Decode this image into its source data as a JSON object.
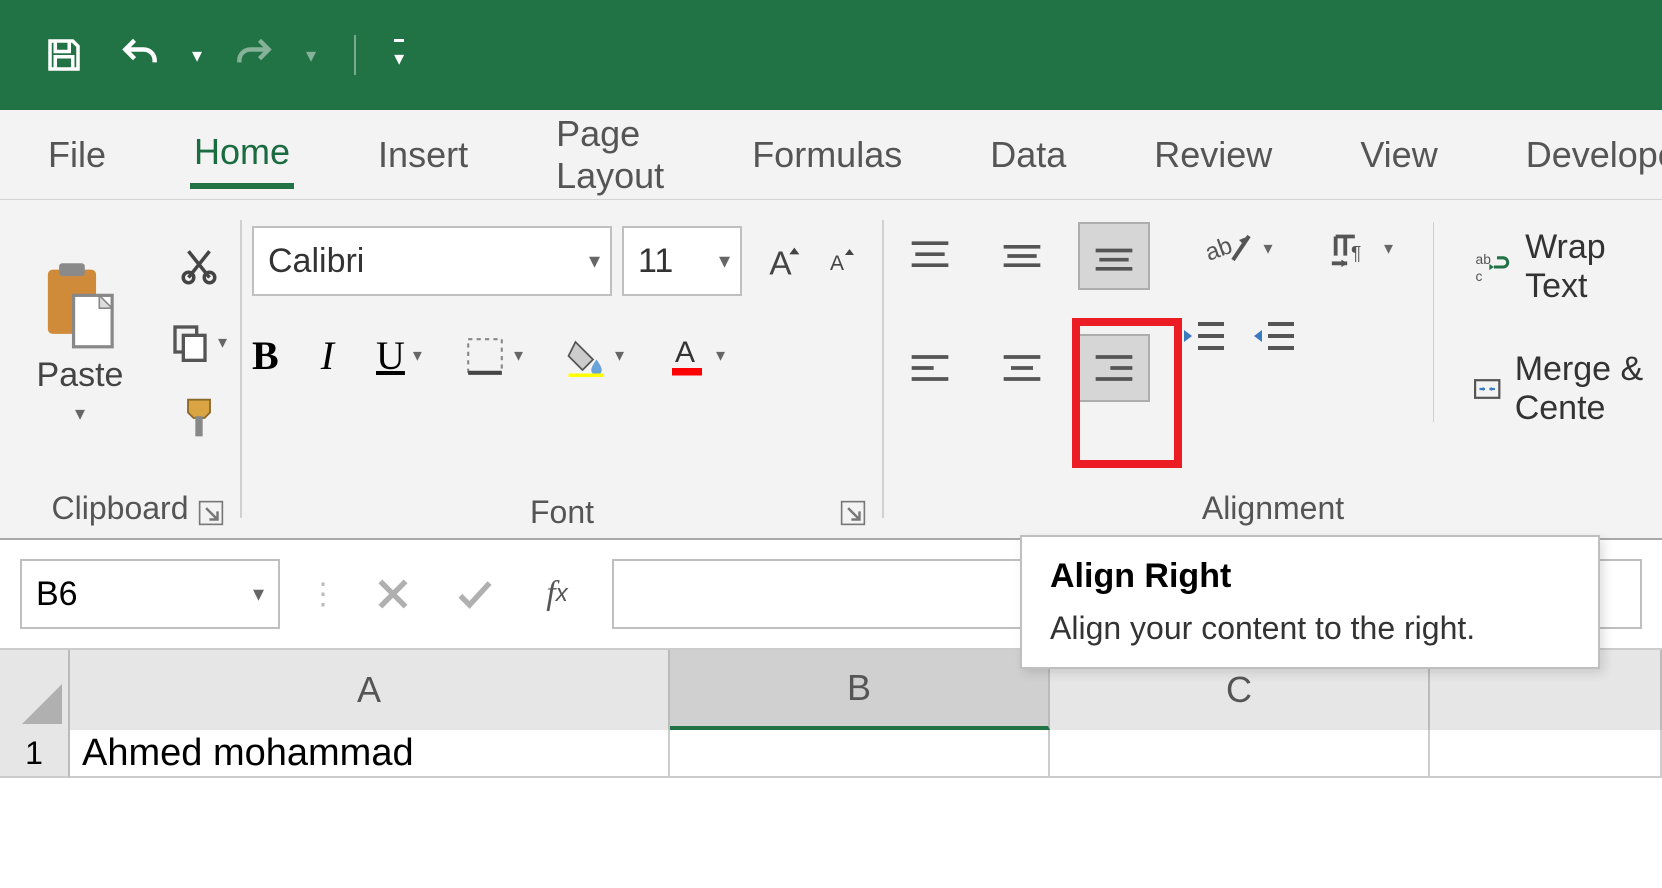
{
  "qat": {
    "save": "save",
    "undo": "undo",
    "redo": "redo"
  },
  "tabs": [
    "File",
    "Home",
    "Insert",
    "Page Layout",
    "Formulas",
    "Data",
    "Review",
    "View",
    "Develope"
  ],
  "active_tab": "Home",
  "clipboard": {
    "label": "Paste",
    "group": "Clipboard"
  },
  "font": {
    "name": "Calibri",
    "size": "11",
    "group": "Font",
    "bold": "B",
    "italic": "I",
    "underline": "U"
  },
  "alignment": {
    "group": "Alignment",
    "wrap": "Wrap Text",
    "merge": "Merge & Cente"
  },
  "tooltip": {
    "title": "Align Right",
    "body": "Align your content to the right."
  },
  "namebox": "B6",
  "columns": [
    "A",
    "B",
    "C"
  ],
  "row1": {
    "num": "1",
    "A": "Ahmed mohammad"
  }
}
